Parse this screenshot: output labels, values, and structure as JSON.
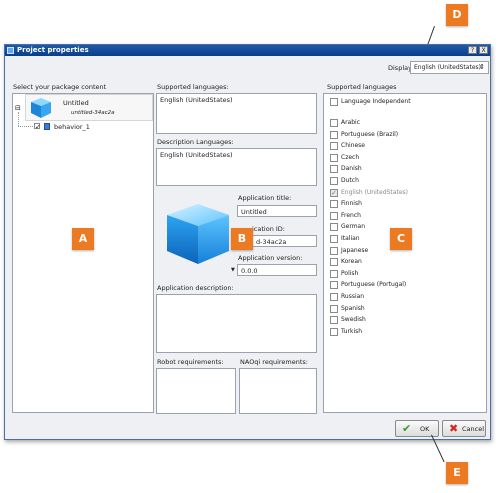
{
  "window": {
    "title": "Project properties",
    "help_button": "?",
    "close_button": "X"
  },
  "header": {
    "displayed_language_label": "Displayed language",
    "displayed_language_value": "English (UnitedStates)"
  },
  "left": {
    "heading": "Select your package content",
    "project": {
      "name": "Untitled",
      "id": "untitled-34ac2a",
      "expander": "⊟"
    },
    "behavior": {
      "name": "behavior_1"
    }
  },
  "middle": {
    "supported_languages_label": "Supported languages:",
    "supported_languages_value": "English (UnitedStates)",
    "description_languages_label": "Description Languages:",
    "description_languages_value": "English (UnitedStates)",
    "app_title_label": "Application title:",
    "app_title_value": "Untitled",
    "app_id_label": "ication ID:",
    "app_id_value": "d-34ac2a",
    "app_version_label": "Application version:",
    "app_version_value": "0.0.0",
    "app_description_label": "Application description:",
    "robot_requirements_label": "Robot requirements:",
    "naoqi_requirements_label": "NAOqi requirements:"
  },
  "right": {
    "heading": "Supported languages",
    "independent": "Language Independent",
    "languages": [
      {
        "name": "Arabic",
        "checked": false
      },
      {
        "name": "Portuguese (Brazil)",
        "checked": false
      },
      {
        "name": "Chinese",
        "checked": false
      },
      {
        "name": "Czech",
        "checked": false
      },
      {
        "name": "Danish",
        "checked": false
      },
      {
        "name": "Dutch",
        "checked": false
      },
      {
        "name": "English (UnitedStates)",
        "checked": true
      },
      {
        "name": "Finnish",
        "checked": false
      },
      {
        "name": "French",
        "checked": false
      },
      {
        "name": "German",
        "checked": false
      },
      {
        "name": "Italian",
        "checked": false
      },
      {
        "name": "Japanese",
        "checked": false
      },
      {
        "name": "Korean",
        "checked": false
      },
      {
        "name": "Polish",
        "checked": false
      },
      {
        "name": "Portuguese (Portugal)",
        "checked": false
      },
      {
        "name": "Russian",
        "checked": false
      },
      {
        "name": "Spanish",
        "checked": false
      },
      {
        "name": "Swedish",
        "checked": false
      },
      {
        "name": "Turkish",
        "checked": false
      }
    ]
  },
  "buttons": {
    "ok": "OK",
    "cancel": "Cancel"
  },
  "callouts": {
    "a": "A",
    "b": "B",
    "c": "C",
    "d": "D",
    "e": "E"
  },
  "colors": {
    "titlebar": "#0a3d8a",
    "callout": "#ec7a22",
    "panel_border": "#9aa3ad"
  }
}
